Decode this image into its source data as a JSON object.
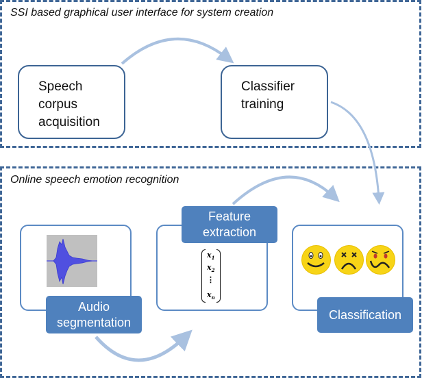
{
  "top_section": {
    "title": "SSI based graphical user interface for system creation",
    "steps": [
      {
        "lines": [
          "Speech",
          "corpus",
          "acquisition"
        ]
      },
      {
        "lines": [
          "Classifier",
          "training"
        ]
      }
    ]
  },
  "bottom_section": {
    "title": "Online speech emotion recognition",
    "stages": [
      {
        "label_lines": [
          "Audio",
          "segmentation"
        ],
        "content_icon": "waveform-icon"
      },
      {
        "label_lines": [
          "Feature",
          "extraction"
        ],
        "content_icon": "feature-vector-icon",
        "vector": [
          {
            "base": "x",
            "sub": "1"
          },
          {
            "base": "x",
            "sub": "2"
          },
          {
            "base": "⋮",
            "sub": ""
          },
          {
            "base": "x",
            "sub": "n"
          }
        ]
      },
      {
        "label_lines": [
          "Classification"
        ],
        "content_icon": "emotion-faces-icon",
        "faces": [
          "happy-face-icon",
          "sad-face-icon",
          "angry-face-icon"
        ]
      }
    ]
  },
  "colors": {
    "frame_border": "#3f6696",
    "box_border": "#3c6494",
    "label_fill": "#4f81bd",
    "arrow": "#a9c1e0",
    "face_fill": "#f7d417"
  }
}
